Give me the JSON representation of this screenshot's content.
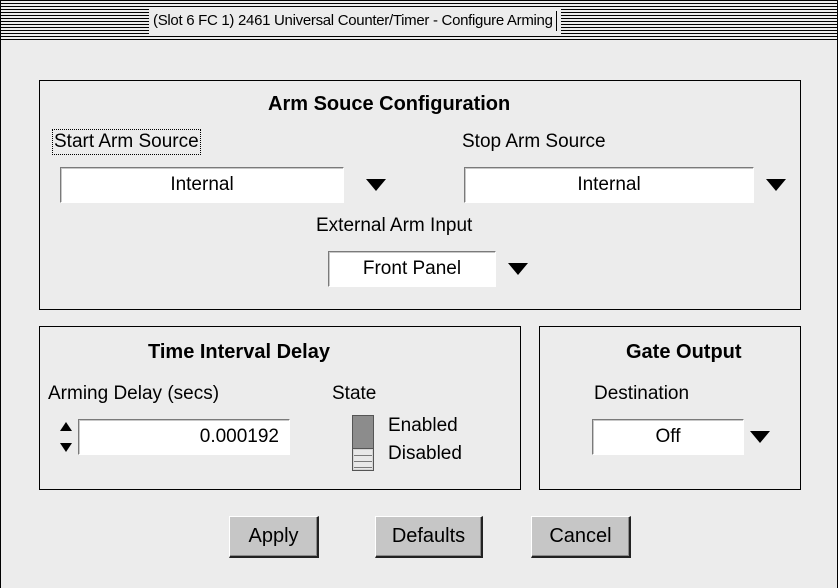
{
  "window": {
    "title": "(Slot 6 FC 1) 2461 Universal Counter/Timer - Configure Arming"
  },
  "arm_source": {
    "title": "Arm Souce Configuration",
    "start_label": "Start Arm Source",
    "start_value": "Internal",
    "stop_label": "Stop Arm Source",
    "stop_value": "Internal",
    "external_label": "External Arm Input",
    "external_value": "Front Panel"
  },
  "time_interval": {
    "title": "Time Interval Delay",
    "delay_label": "Arming Delay (secs)",
    "delay_value": "0.000192",
    "state_label": "State",
    "state_enabled": "Enabled",
    "state_disabled": "Disabled"
  },
  "gate_output": {
    "title": "Gate Output",
    "destination_label": "Destination",
    "destination_value": "Off"
  },
  "buttons": {
    "apply": "Apply",
    "defaults": "Defaults",
    "cancel": "Cancel"
  }
}
